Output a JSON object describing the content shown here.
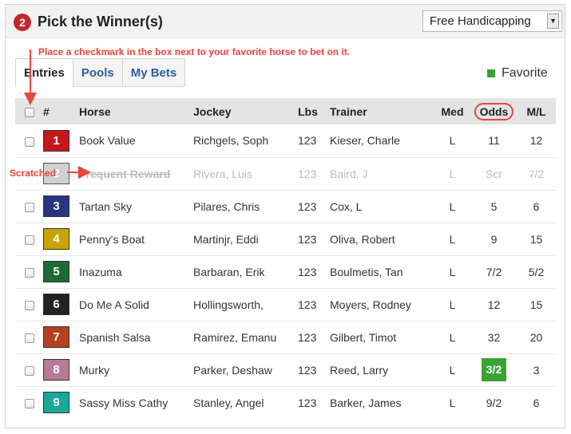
{
  "header": {
    "step_number": "2",
    "title": "Pick the Winner(s)",
    "dropdown_value": "Free Handicapping",
    "dropdown_arrow": "▼"
  },
  "instruction": "Place a checkmark in the box next to your favorite horse to bet on it.",
  "tabs": [
    {
      "label": "Entries",
      "active": true
    },
    {
      "label": "Pools",
      "active": false
    },
    {
      "label": "My Bets",
      "active": false
    }
  ],
  "legend": {
    "label": "Favorite",
    "color": "#3aa335"
  },
  "columns": {
    "number": "#",
    "horse": "Horse",
    "jockey": "Jockey",
    "lbs": "Lbs",
    "trainer": "Trainer",
    "med": "Med",
    "odds": "Odds",
    "ml": "M/L"
  },
  "entries": [
    {
      "num": "1",
      "horse": "Book Value",
      "jockey": "Richgels, Soph",
      "lbs": "123",
      "trainer": "Kieser, Charle",
      "med": "L",
      "odds": "11",
      "ml": "12",
      "color": "#c4161c",
      "scratched": false,
      "favorite": false
    },
    {
      "num": "2",
      "horse": "Frequent Reward",
      "jockey": "Rivera, Luis",
      "lbs": "123",
      "trainer": "Baird, J",
      "med": "L",
      "odds": "Scr",
      "ml": "7/2",
      "color": "#d0d0d0",
      "scratched": true,
      "favorite": false
    },
    {
      "num": "3",
      "horse": "Tartan Sky",
      "jockey": "Pilares, Chris",
      "lbs": "123",
      "trainer": "Cox, L",
      "med": "L",
      "odds": "5",
      "ml": "6",
      "color": "#27367f",
      "scratched": false,
      "favorite": false
    },
    {
      "num": "4",
      "horse": "Penny's Boat",
      "jockey": "Martinjr, Eddi",
      "lbs": "123",
      "trainer": "Oliva, Robert",
      "med": "L",
      "odds": "9",
      "ml": "15",
      "color": "#c9a400",
      "scratched": false,
      "favorite": false
    },
    {
      "num": "5",
      "horse": "Inazuma",
      "jockey": "Barbaran, Erik",
      "lbs": "123",
      "trainer": "Boulmetis, Tan",
      "med": "L",
      "odds": "7/2",
      "ml": "5/2",
      "color": "#1d6b34",
      "scratched": false,
      "favorite": false
    },
    {
      "num": "6",
      "horse": "Do Me A Solid",
      "jockey": "Hollingsworth,",
      "lbs": "123",
      "trainer": "Moyers, Rodney",
      "med": "L",
      "odds": "12",
      "ml": "15",
      "color": "#222222",
      "scratched": false,
      "favorite": false
    },
    {
      "num": "7",
      "horse": "Spanish Salsa",
      "jockey": "Ramirez, Emanu",
      "lbs": "123",
      "trainer": "Gilbert, Timot",
      "med": "L",
      "odds": "32",
      "ml": "20",
      "color": "#b5421f",
      "scratched": false,
      "favorite": false
    },
    {
      "num": "8",
      "horse": "Murky",
      "jockey": "Parker, Deshaw",
      "lbs": "123",
      "trainer": "Reed, Larry",
      "med": "L",
      "odds": "3/2",
      "ml": "3",
      "color": "#b77a98",
      "scratched": false,
      "favorite": true
    },
    {
      "num": "9",
      "horse": "Sassy Miss Cathy",
      "jockey": "Stanley, Angel",
      "lbs": "123",
      "trainer": "Barker, James",
      "med": "L",
      "odds": "9/2",
      "ml": "6",
      "color": "#1aa89a",
      "scratched": false,
      "favorite": false
    }
  ],
  "annotations": {
    "scratched_label": "Scratched",
    "annotation_color": "#e8453c"
  }
}
